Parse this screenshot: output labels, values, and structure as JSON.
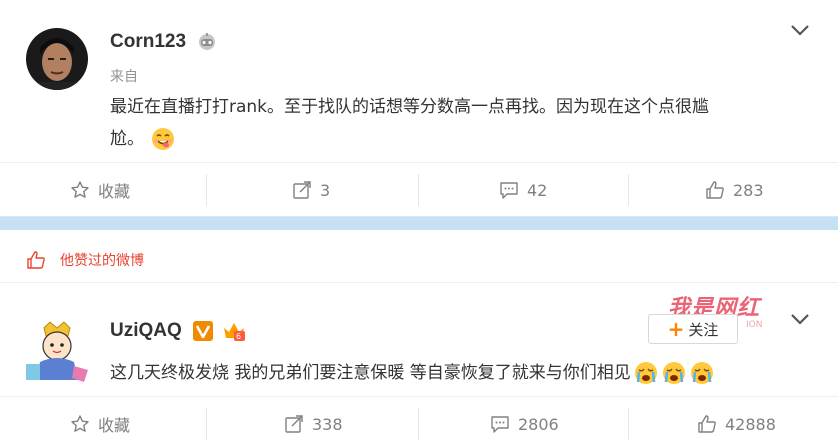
{
  "post1": {
    "username": "Corn123",
    "source": "来自",
    "content_line1": "最近在直播打打rank。至于找队的话想等分数高一点再找。因为现在这个点很尴",
    "content_line2": "尬。",
    "actions": {
      "favorite_label": "收藏",
      "repost_count": "3",
      "comment_count": "42",
      "like_count": "283"
    }
  },
  "liked_bar": {
    "label": "他赞过的微博"
  },
  "post2": {
    "username": "UziQAQ",
    "content": "这几天终极发烧 我的兄弟们要注意保暖 等自豪恢复了就来与你们相见",
    "follow_label": "关注",
    "follow_plus": "+",
    "actions": {
      "favorite_label": "收藏",
      "repost_count": "338",
      "comment_count": "2806",
      "like_count": "42888"
    }
  },
  "watermark": {
    "text": "我是网红",
    "sub": "ION"
  },
  "colors": {
    "accent_red": "#e8432f",
    "follow_orange": "#ff8200",
    "divider_blue": "#c6e1f3",
    "vip_orange": "#f08a00"
  }
}
